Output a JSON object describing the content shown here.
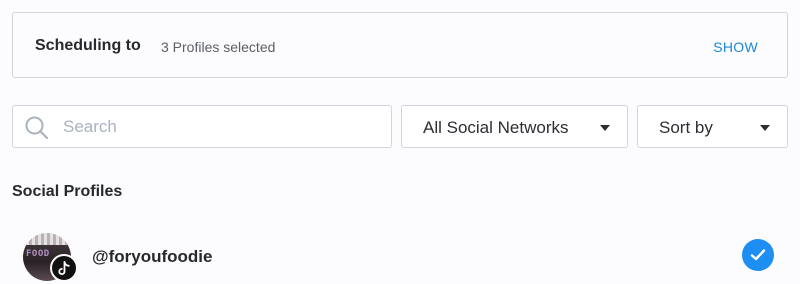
{
  "scheduling": {
    "title": "Scheduling to",
    "count_text": "3 Profiles selected",
    "show_label": "SHOW"
  },
  "search": {
    "placeholder": "Search",
    "value": ""
  },
  "filters": {
    "networks_selected": "All Social Networks",
    "sort_selected": "Sort by"
  },
  "profiles_section": {
    "title": "Social Profiles",
    "items": [
      {
        "handle": "@foryoufoodie",
        "network": "tiktok",
        "avatar_text": "FOOD",
        "selected": true
      }
    ]
  },
  "colors": {
    "accent": "#1b8ad6",
    "check": "#1d8ff2",
    "border": "#cfd6dc",
    "placeholder": "#a9b3bf"
  },
  "icons": {
    "search": "search-icon",
    "caret": "caret-down-icon",
    "network_badge": "tiktok-icon",
    "selected": "checkmark-icon"
  }
}
